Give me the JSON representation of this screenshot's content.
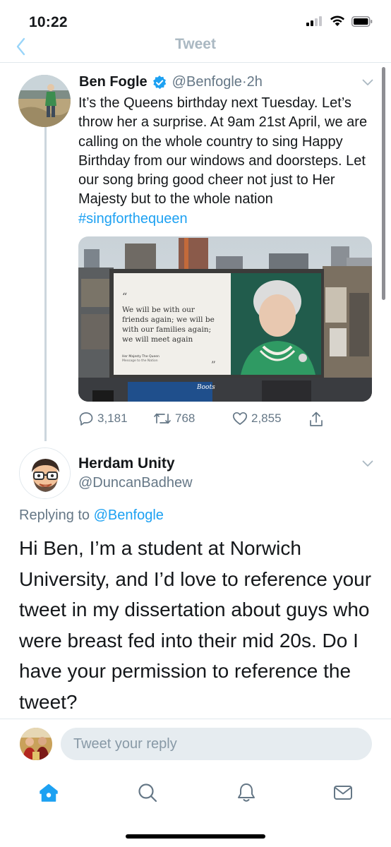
{
  "status_bar": {
    "time": "10:22"
  },
  "nav": {
    "title": "Tweet"
  },
  "tweet": {
    "author_name": "Ben Fogle",
    "author_handle": "@Benfogle",
    "time_sep": " · ",
    "age": "2h",
    "text": "It’s the Queens birthday next Tuesday. Let’s throw her a surprise. At 9am 21st April, we are calling on the whole country to sing Happy Birthday from our windows and doorsteps. Let our song bring good cheer not just to Her Majesty but to the whole nation ",
    "hashtag": "#singforthequeen",
    "billboard_quote": [
      "We will be with our",
      "friends again; we will be",
      "with our families again;",
      "we will meet again"
    ],
    "billboard_attribution": [
      "Her Majesty The Queen",
      "Message to the Nation"
    ],
    "billboard_quote_open": "“",
    "billboard_quote_close": "”",
    "store_sign": "Boots",
    "replies": "3,181",
    "retweets": "768",
    "likes": "2,855"
  },
  "reply": {
    "author_name": "Herdam Unity",
    "author_handle": "@DuncanBadhew",
    "replying_prefix": "Replying to ",
    "replying_to": "@Benfogle",
    "text": "Hi Ben, I’m a student at Norwich University, and I’d love to reference your tweet in my dissertation about guys who were breast fed into their mid 20s. Do I have your permission to reference the tweet?"
  },
  "compose": {
    "placeholder": "Tweet your reply"
  },
  "colors": {
    "accent": "#1da1f2",
    "secondary_text": "#657786",
    "divider": "#e1e8ed",
    "nav_title": "#aab8c2"
  },
  "icons": [
    "back-chevron-icon",
    "verified-badge-icon",
    "chevron-down-icon",
    "reply-icon",
    "retweet-icon",
    "like-icon",
    "share-icon",
    "home-icon",
    "search-icon",
    "notifications-icon",
    "messages-icon"
  ]
}
